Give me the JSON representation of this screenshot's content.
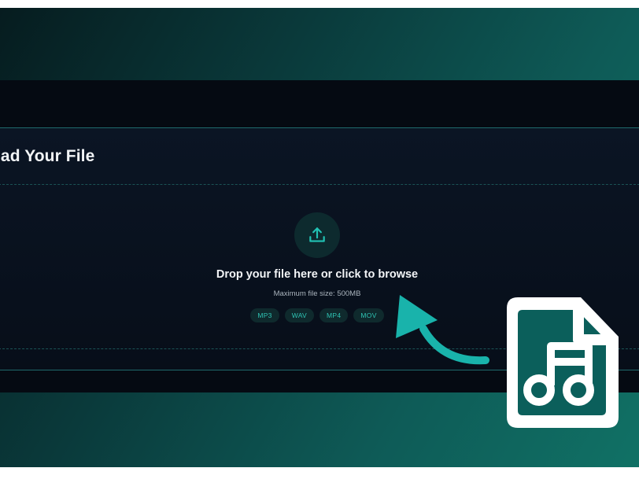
{
  "upload_card": {
    "title": "oad Your File"
  },
  "dropzone": {
    "title": "Drop your file here or click to browse",
    "subtitle": "Maximum file size: 500MB",
    "formats": [
      "MP3",
      "WAV",
      "MP4",
      "MOV"
    ],
    "icon": "upload-icon"
  },
  "overlay": {
    "arrow_icon": "curved-arrow-icon",
    "file_icon": "audio-file-icon"
  },
  "colors": {
    "accent": "#19b3ab",
    "background_gradient_start": "#061c1f",
    "background_gradient_end": "#107165",
    "app_background": "#050a12",
    "card_border": "#1f6a6c",
    "chip_text": "#2fc4b4",
    "chip_background": "#0f2a2d"
  }
}
